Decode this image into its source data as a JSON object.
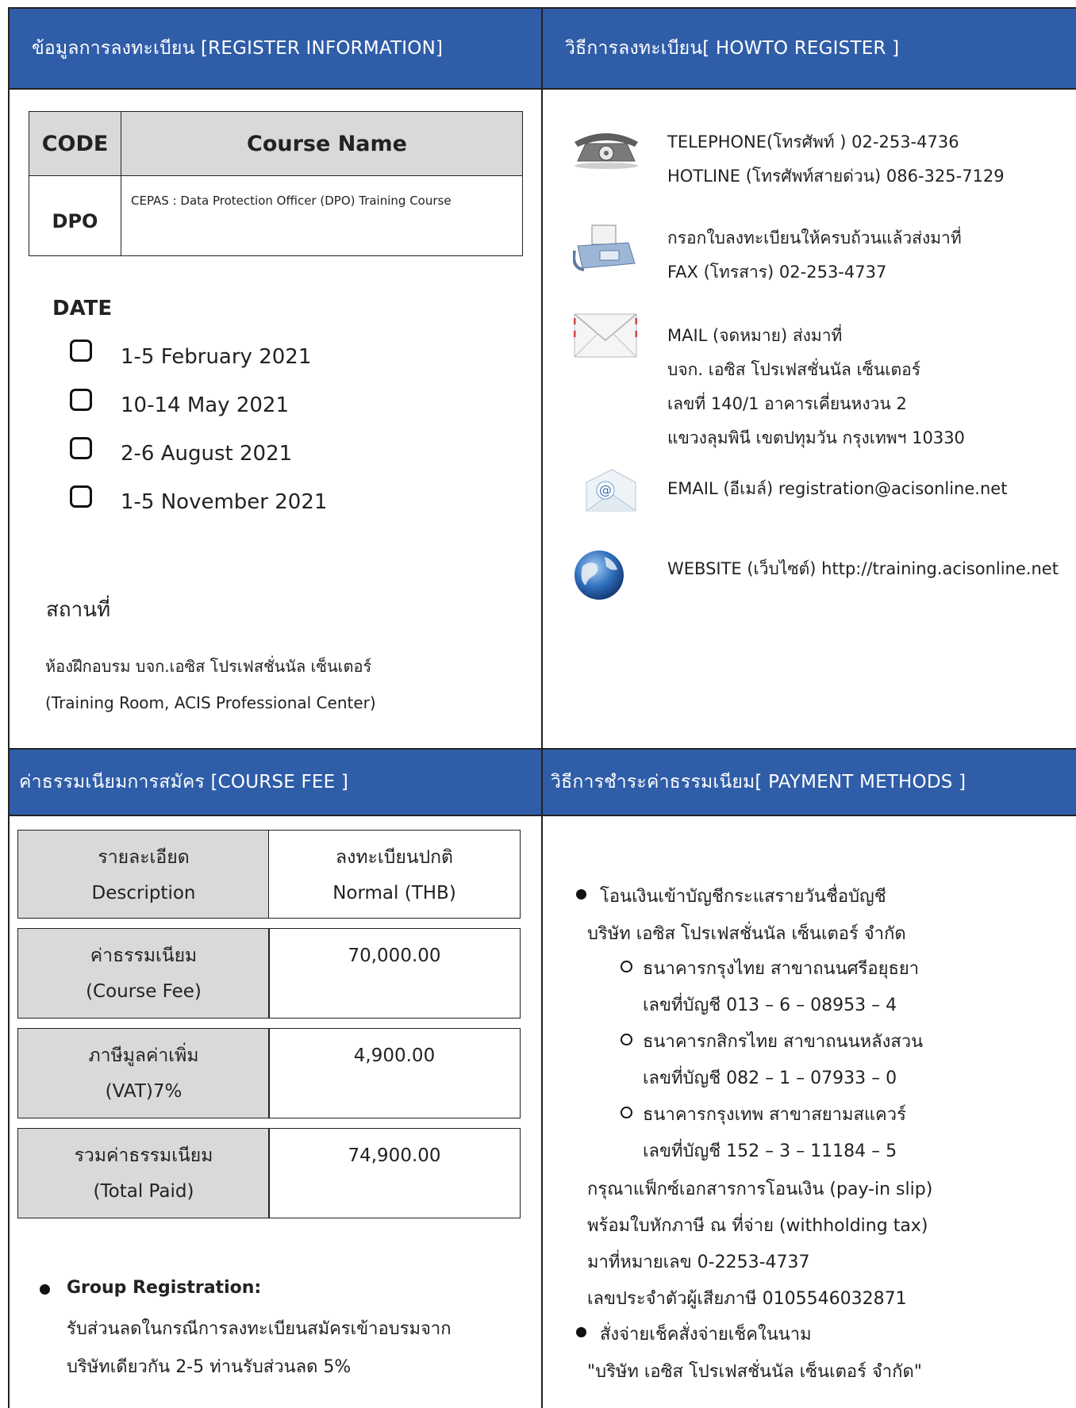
{
  "register_info": {
    "header": "ข้อมูลการลงทะเบียน [REGISTER INFORMATION]",
    "course_table": {
      "col_code": "CODE",
      "col_name": "Course Name",
      "code": "DPO",
      "name": "CEPAS : Data Protection Officer (DPO) Training Course"
    },
    "date_label": "DATE",
    "dates": [
      "1-5 February 2021",
      "10-14 May 2021",
      "2-6 August 2021",
      "1-5 November 2021"
    ],
    "venue_label": "สถานที่",
    "venue_th": "ห้องฝึกอบรม บจก.เอซิส โปรเฟสชั่นนัล เซ็นเตอร์",
    "venue_en": "(Training Room, ACIS Professional Center)"
  },
  "how_to_register": {
    "header": "วิธีการลงทะเบียน[ HOWTO REGISTER ]",
    "telephone": [
      "TELEPHONE(โทรศัพท์ ) 02-253-4736",
      "HOTLINE (โทรศัพท์สายด่วน) 086-325-7129"
    ],
    "fax": [
      "กรอกใบลงทะเบียนให้ครบถ้วนแล้วส่งมาที่",
      "FAX (โทรสาร) 02-253-4737"
    ],
    "mail": [
      "MAIL (จดหมาย) ส่งมาที่",
      "บจก. เอซิส โปรเฟสชั่นนัล เซ็นเตอร์",
      "เลขที่ 140/1 อาคารเคี่ยนหงวน 2",
      "แขวงลุมพินี เขตปทุมวัน กรุงเทพฯ 10330"
    ],
    "email": "EMAIL (อีเมล์) registration@acisonline.net",
    "website": "WEBSITE (เว็บไซต์) http://training.acisonline.net",
    "icons": [
      "telephone-icon",
      "fax-icon",
      "envelope-icon",
      "email-icon",
      "globe-icon"
    ]
  },
  "course_fee": {
    "header": "ค่าธรรมเนียมการสมัคร [COURSE FEE ]",
    "table": {
      "head": {
        "desc_th": "รายละเอียด",
        "desc_en": "Description",
        "normal_th": "ลงทะเบียนปกติ",
        "normal_en": "Normal (THB)"
      },
      "rows": [
        {
          "label_th": "ค่าธรรมเนียม",
          "label_en": "(Course Fee)",
          "value": "70,000.00"
        },
        {
          "label_th": "ภาษีมูลค่าเพิ่ม",
          "label_en": "(VAT)7%",
          "value": "4,900.00"
        },
        {
          "label_th": "รวมค่าธรรมเนียม",
          "label_en": "(Total Paid)",
          "value": "74,900.00"
        }
      ]
    },
    "group_title": "Group Registration:",
    "group_text": [
      "รับส่วนลดในกรณีการลงทะเบียนสมัครเข้าอบรมจาก",
      "บริษัทเดียวกัน 2-5 ท่านรับส่วนลด 5%"
    ]
  },
  "payment": {
    "header": "วิธีการชำระค่าธรรมเนียม[ PAYMENT METHODS ]",
    "transfer_title": "โอนเงินเข้าบัญชีกระแสรายวันชื่อบัญชี",
    "transfer_company": "บริษัท เอซิส โปรเฟสชั่นนัล เซ็นเตอร์ จำกัด",
    "banks": [
      {
        "name": "ธนาคารกรุงไทย สาขาถนนศรีอยุธยา",
        "account": "เลขที่บัญชี 013 – 6 – 08953 – 4"
      },
      {
        "name": "ธนาคารกสิกรไทย สาขาถนนหลังสวน",
        "account": "เลขที่บัญชี 082 – 1 – 07933 – 0"
      },
      {
        "name": "ธนาคารกรุงเทพ สาขาสยามสแควร์",
        "account": "เลขที่บัญชี 152 – 3 – 11184 – 5"
      }
    ],
    "notes": [
      "กรุณาแฟ็กซ์เอกสารการโอนเงิน (pay-in slip)",
      "พร้อมใบหักภาษี ณ ที่จ่าย (withholding tax)",
      "มาที่หมายเลข  0-2253-4737",
      "เลขประจำตัวผู้เสียภาษี 0105546032871"
    ],
    "cheque_title": "สั่งจ่ายเช็คสั่งจ่ายเช็คในนาม",
    "cheque_name": "\"บริษัท เอซิส โปรเฟสชั่นนัล เซ็นเตอร์ จำกัด\""
  }
}
